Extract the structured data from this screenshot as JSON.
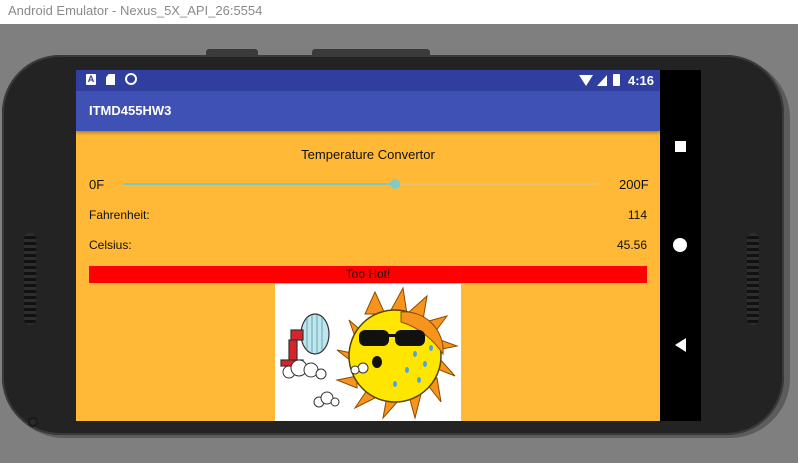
{
  "window": {
    "title": "Android Emulator - Nexus_5X_API_26:5554"
  },
  "status_bar": {
    "time": "4:16",
    "icons": [
      "a-notification-icon",
      "sd-card-icon",
      "sync-circle-icon",
      "wifi-icon",
      "signal-icon",
      "battery-icon"
    ]
  },
  "app_bar": {
    "title": "ITMD455HW3"
  },
  "main": {
    "heading": "Temperature Convertor",
    "slider": {
      "min_label": "0F",
      "max_label": "200F",
      "value": 114,
      "min": 0,
      "max": 200
    },
    "fahrenheit": {
      "label": "Fahrenheit:",
      "value": "114"
    },
    "celsius": {
      "label": "Celsius:",
      "value": "45.56"
    },
    "banner": {
      "text": "Too Hot!",
      "color": "#FF0000"
    },
    "image": {
      "description_icon": "hot-sun-with-fan-icon"
    }
  },
  "nav_bar": {
    "buttons": [
      "recents-square-icon",
      "home-circle-icon",
      "back-triangle-icon"
    ]
  },
  "colors": {
    "background": "#FFB937",
    "status_bar": "#303F9F",
    "app_bar": "#3F51B5",
    "accent": "#80CBC4",
    "warning": "#FF0000"
  }
}
